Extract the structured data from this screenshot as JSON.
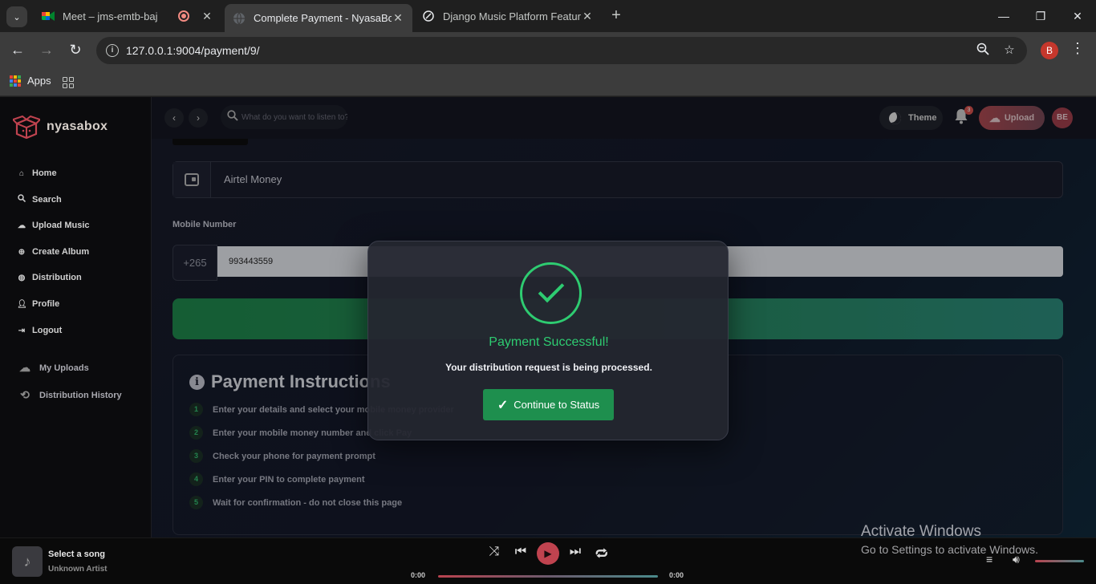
{
  "browser": {
    "tabs": [
      {
        "title": "Meet – jms-emtb-baj",
        "icon": "google-meet-icon"
      },
      {
        "title": "Complete Payment - NyasaBox",
        "icon": "globe-icon"
      },
      {
        "title": "Django Music Platform Features",
        "icon": "chatgpt-icon"
      }
    ],
    "url": "127.0.0.1:9004/payment/9/",
    "profile_initial": "B",
    "bookmarks": {
      "apps_label": "Apps"
    }
  },
  "app": {
    "brand": "nyasabox",
    "nav": [
      {
        "label": "Home",
        "icon": "home-icon"
      },
      {
        "label": "Search",
        "icon": "search-icon"
      },
      {
        "label": "Upload Music",
        "icon": "cloud-upload-icon"
      },
      {
        "label": "Create Album",
        "icon": "plus-circle-icon"
      },
      {
        "label": "Distribution",
        "icon": "globe-icon"
      },
      {
        "label": "Profile",
        "icon": "user-icon"
      },
      {
        "label": "Logout",
        "icon": "logout-icon"
      }
    ],
    "nav_secondary": [
      {
        "label": "My Uploads",
        "icon": "cloud-upload-icon"
      },
      {
        "label": "Distribution History",
        "icon": "history-icon"
      }
    ],
    "topbar": {
      "search_placeholder": "What do you want to listen to?",
      "theme_label": "Theme",
      "notification_count": "3",
      "upload_label": "Upload",
      "avatar_initials": "BE"
    }
  },
  "payment": {
    "method": "Airtel Money",
    "mobile_label": "Mobile Number",
    "prefix": "+265",
    "mobile_value": "993443559",
    "instructions_title": "Payment Instructions",
    "steps": [
      "Enter your details and select your mobile money provider",
      "Enter your mobile money number and click Pay",
      "Check your phone for payment prompt",
      "Enter your PIN to complete payment",
      "Wait for confirmation - do not close this page"
    ]
  },
  "modal": {
    "title": "Payment Successful!",
    "message": "Your distribution request is being processed.",
    "button_label": "Continue to Status"
  },
  "player": {
    "song": "Select a song",
    "artist": "Unknown Artist",
    "current_time": "0:00",
    "duration": "0:00"
  },
  "watermark": {
    "line1": "Activate Windows",
    "line2": "Go to Settings to activate Windows."
  },
  "colors": {
    "success": "#2ecc71",
    "accent": "#c0434f",
    "pay_button": "#1f8a4d"
  }
}
